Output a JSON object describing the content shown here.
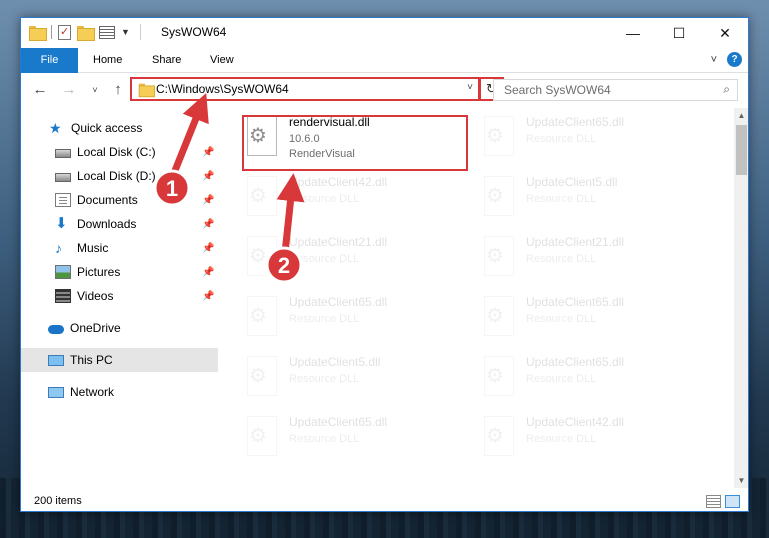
{
  "window": {
    "title": "SysWOW64",
    "controls": {
      "minimize": "—",
      "maximize": "☐",
      "close": "✕"
    }
  },
  "ribbon": {
    "tabs": [
      "File",
      "Home",
      "Share",
      "View"
    ],
    "collapse_glyph": "˅",
    "help_glyph": "?"
  },
  "nav": {
    "back_glyph": "←",
    "forward_glyph": "→",
    "recent_glyph": "˅",
    "up_glyph": "↑",
    "address": "C:\\Windows\\SysWOW64",
    "address_dropdown_glyph": "˅",
    "refresh_glyph": "↻",
    "search_placeholder": "Search SysWOW64",
    "search_glyph": "⌕"
  },
  "sidebar": {
    "items": [
      {
        "label": "Quick access",
        "icon": "star-icon",
        "glyph": "★",
        "pinned": false
      },
      {
        "label": "Local Disk (C:)",
        "icon": "drive-icon",
        "glyph": "",
        "pinned": true
      },
      {
        "label": "Local Disk (D:)",
        "icon": "drive-icon",
        "glyph": "",
        "pinned": true
      },
      {
        "label": "Documents",
        "icon": "documents-icon",
        "glyph": "",
        "pinned": true
      },
      {
        "label": "Downloads",
        "icon": "download-icon",
        "glyph": "⬇",
        "pinned": true
      },
      {
        "label": "Music",
        "icon": "music-icon",
        "glyph": "♪",
        "pinned": true
      },
      {
        "label": "Pictures",
        "icon": "pictures-icon",
        "glyph": "",
        "pinned": true
      },
      {
        "label": "Videos",
        "icon": "videos-icon",
        "glyph": "",
        "pinned": true
      },
      {
        "label": "OneDrive",
        "icon": "cloud-icon",
        "glyph": "",
        "pinned": false
      },
      {
        "label": "This PC",
        "icon": "computer-icon",
        "glyph": "",
        "pinned": false,
        "selected": true
      },
      {
        "label": "Network",
        "icon": "network-icon",
        "glyph": "",
        "pinned": false
      }
    ],
    "pin_glyph": "📌"
  },
  "files": [
    {
      "name": "rendervisual.dll",
      "line1": "10.6.0",
      "line2": "RenderVisual",
      "highlighted": true
    },
    {
      "name": "UpdateClient65.dll",
      "line1": "Resource DLL",
      "line2": "",
      "highlighted": false
    },
    {
      "name": "UpdateClient42.dll",
      "line1": "Resource DLL",
      "line2": "",
      "highlighted": false
    },
    {
      "name": "UpdateClient5.dll",
      "line1": "Resource DLL",
      "line2": "",
      "highlighted": false
    },
    {
      "name": "UpdateClient21.dll",
      "line1": "Resource DLL",
      "line2": "",
      "highlighted": false
    },
    {
      "name": "UpdateClient21.dll",
      "line1": "Resource DLL",
      "line2": "",
      "highlighted": false
    },
    {
      "name": "UpdateClient65.dll",
      "line1": "Resource DLL",
      "line2": "",
      "highlighted": false
    },
    {
      "name": "UpdateClient65.dll",
      "line1": "Resource DLL",
      "line2": "",
      "highlighted": false
    },
    {
      "name": "UpdateClient5.dll",
      "line1": "Resource DLL",
      "line2": "",
      "highlighted": false
    },
    {
      "name": "UpdateClient65.dll",
      "line1": "Resource DLL",
      "line2": "",
      "highlighted": false
    },
    {
      "name": "UpdateClient65.dll",
      "line1": "Resource DLL",
      "line2": "",
      "highlighted": false
    },
    {
      "name": "UpdateClient42.dll",
      "line1": "Resource DLL",
      "line2": "",
      "highlighted": false
    }
  ],
  "scrollbar": {
    "up_glyph": "▲",
    "down_glyph": "▼"
  },
  "status": {
    "item_count": "200 items"
  },
  "annotations": [
    {
      "label": "1",
      "color": "#d9383a"
    },
    {
      "label": "2",
      "color": "#d9383a"
    }
  ],
  "colors": {
    "accent": "#1979ca",
    "annotation": "#d9383a",
    "selected_bg": "#e5e5e5"
  }
}
